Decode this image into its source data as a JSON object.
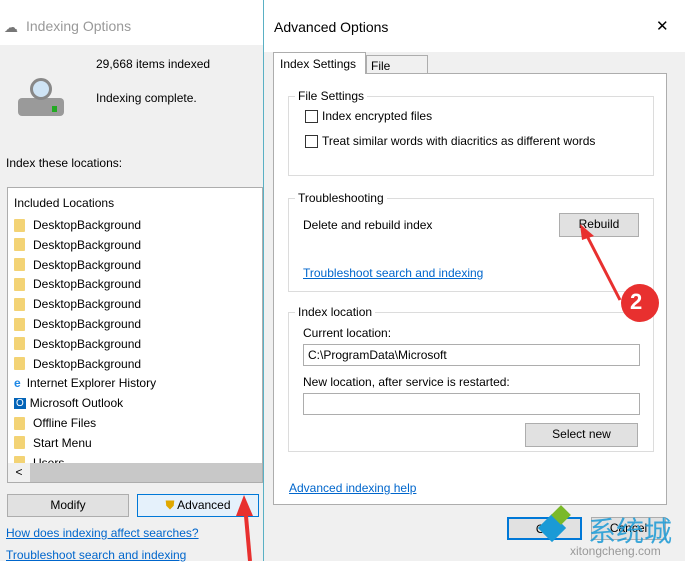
{
  "indexing": {
    "title": "Indexing Options",
    "items_indexed": "29,668 items indexed",
    "status": "Indexing complete.",
    "locations_label": "Index these locations:",
    "list_header": "Included Locations",
    "locations": [
      "DesktopBackground",
      "DesktopBackground",
      "DesktopBackground",
      "DesktopBackground",
      "DesktopBackground",
      "DesktopBackground",
      "DesktopBackground",
      "DesktopBackground",
      "Internet Explorer History",
      "Microsoft Outlook",
      "Offline Files",
      "Start Menu",
      "Users"
    ],
    "modify": "Modify",
    "advanced": "Advanced",
    "link1": "How does indexing affect searches?",
    "link2": "Troubleshoot search and indexing"
  },
  "advanced": {
    "title": "Advanced Options",
    "close": "✕",
    "tabs": [
      "Index Settings",
      "File Types"
    ],
    "file_settings": {
      "label": "File Settings",
      "options": [
        "Index encrypted files",
        "Treat similar words with diacritics as different words"
      ]
    },
    "troubleshooting": {
      "label": "Troubleshooting",
      "rebuild_text": "Delete and rebuild index",
      "rebuild": "Rebuild",
      "link": "Troubleshoot search and indexing"
    },
    "location": {
      "label": "Index location",
      "current_label": "Current location:",
      "current_value": "C:\\ProgramData\\Microsoft",
      "new_label": "New location, after service is restarted:",
      "new_value": "",
      "select_new": "Select new"
    },
    "help_link": "Advanced indexing help",
    "ok": "OK",
    "cancel": "Cancel"
  },
  "annotation": {
    "step": "2",
    "arrow_color": "#e8302f"
  },
  "watermark": {
    "text": "系统城",
    "url": "xitongcheng.com"
  }
}
